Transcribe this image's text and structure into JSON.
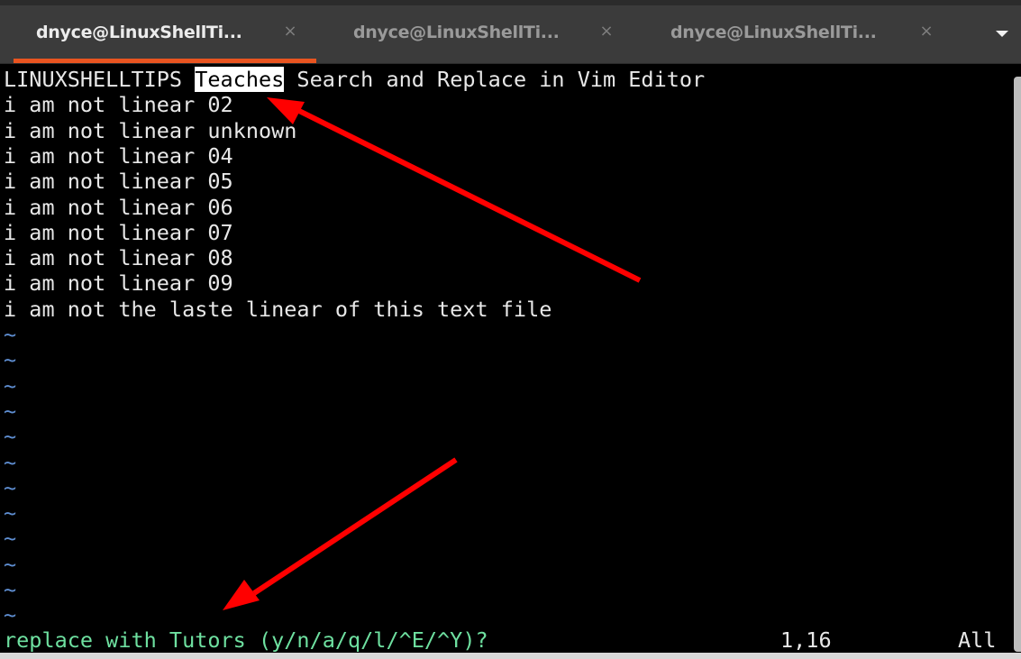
{
  "tabs": [
    {
      "label": "dnyce@LinuxShellTi...",
      "active": true,
      "close_icon": "close-icon"
    },
    {
      "label": "dnyce@LinuxShellTi...",
      "active": false,
      "close_icon": "close-icon"
    },
    {
      "label": "dnyce@LinuxShellTi...",
      "active": false,
      "close_icon": "close-icon"
    }
  ],
  "tab_menu_icon": "chevron-down-icon",
  "close_glyph": "×",
  "editor": {
    "line1": {
      "before": "LINUXSHELLTIPS ",
      "match": "Teaches",
      "after": " Search and Replace in Vim Editor"
    },
    "lines": [
      "i am not linear 02",
      "i am not linear unknown",
      "i am not linear 04",
      "i am not linear 05",
      "i am not linear 06",
      "i am not linear 07",
      "i am not linear 08",
      "i am not linear 09",
      "i am not the laste linear of this text file"
    ],
    "tilde": "~",
    "tilde_count": 12
  },
  "statusline": {
    "prompt": "replace with Tutors (y/n/a/q/l/^E/^Y)?",
    "position": "1,16",
    "scroll": "All"
  },
  "colors": {
    "tab_accent": "#e95420",
    "annotation_arrow": "#ff0000",
    "tilde": "#5f8fd3",
    "prompt": "#6ee0a0"
  }
}
